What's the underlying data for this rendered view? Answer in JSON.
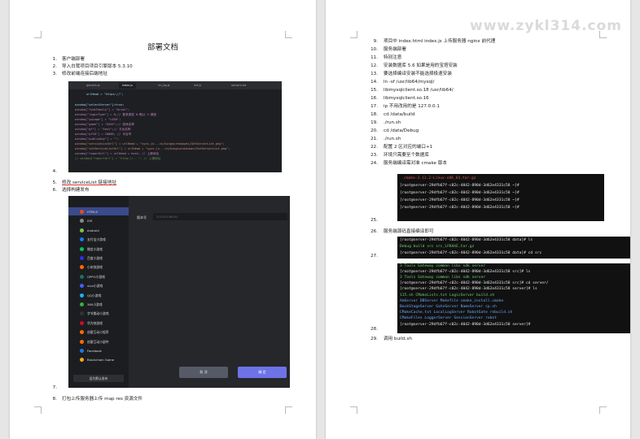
{
  "left": {
    "title": "部署文档",
    "items": [
      {
        "n": "1.",
        "text": "客户端部署"
      },
      {
        "n": "2.",
        "text": "导入白鹭项目项目引擎版本 5.3.10"
      },
      {
        "n": "3.",
        "text": "修改前端连接后端地址"
      },
      {
        "n": "4.",
        "text": ""
      },
      {
        "n": "5.",
        "text": "修改 serviceList 链接地址"
      },
      {
        "n": "6.",
        "text": "选择构建发布"
      },
      {
        "n": "7.",
        "text": ""
      },
      {
        "n": "8.",
        "text": "打包上传服务器上传 map res 资源文件"
      }
    ],
    "code_shot": {
      "tabs": [
        "gameIn.js",
        "index.js",
        "rm_bg.js",
        "init.js",
        "servers.txt"
      ],
      "lines": [
        "urlHead = \"https://\";",
        "",
        "window[\"selectServer\"]=true;",
        "window[\"fontFamily\"] = \"Arial\";",
        "window[\"loginType\"] = 0;// 登录类型 0:默认 1:微信",
        "window[\"ywLogo\"] = \"LOGO\";",
        "window[\"game\"] = \"XXXX\";// 游戏名称",
        "window[\"gf\"] = \"test\";// 平台名称",
        "window[\"pf10\"] = 10000; // 平台号",
        "window[\"publicKey\"] = \"\";",
        "window[\"serviceListUrl\"] = urlHead + \"sycs.js...cn/kingsurnhanwei/GetServerList.php\";",
        "window[\"setServiceListUrl\"] = urlHead + \"sycs.js...cn/kingsurnhanwei/SetServerList.php\";",
        "window[\"reportUrl\"] = urlHead + host; // 上报地址",
        "// window[\"reportUrl\"] = \"http://...\"; // 上报地址"
      ]
    },
    "build_shot": {
      "version_label": "版本号",
      "version_value": "20230706001",
      "platforms": [
        "HTML5",
        "iOS",
        "Android",
        "支付宝小游戏",
        "微信小游戏",
        "百度小游戏",
        "小米快游戏",
        "OPPO小游戏",
        "vivo小游戏",
        "QQ小游戏",
        "360小游戏",
        "字节跳动小游戏",
        "华为快游戏",
        "创意互动小程序",
        "创意互动小部件",
        "Facebook",
        "Blockchain Game"
      ],
      "platform_colors": [
        "#e34c26",
        "#888888",
        "#78c257",
        "#1677ff",
        "#07c160",
        "#2932e1",
        "#ff6900",
        "#1e6e5e",
        "#415fff",
        "#12b7f5",
        "#3dad3d",
        "#333333",
        "#cf0a2c",
        "#ff6a00",
        "#ff6a00",
        "#1877f2",
        "#f5a623"
      ],
      "set_default_button": "设为默认发布",
      "cancel_button": "取 消",
      "confirm_button": "确 定"
    }
  },
  "right": {
    "watermark": "www.zykl314.com",
    "items": [
      {
        "n": "9.",
        "text": "项目中 index.html index.js 上传服务器 nginx 前代理"
      },
      {
        "n": "10.",
        "text": "服务端部署"
      },
      {
        "n": "11.",
        "text": "特别注意"
      },
      {
        "n": "12.",
        "text": "安装数据库 5.6 如果是用的宝塔安装"
      },
      {
        "n": "13.",
        "text": "要选择编译安装不能选择极速安装"
      },
      {
        "n": "14.",
        "text": "ln -sf /usr/lib64/mysql/"
      },
      {
        "n": "15.",
        "text": "libmysqlclient.so.18 /usr/lib64/"
      },
      {
        "n": "16.",
        "text": "libmysqlclient.so.16"
      },
      {
        "n": "17.",
        "text": "ip 不用改用的是 127.0.0.1"
      },
      {
        "n": "18.",
        "text": "cd /data/build"
      },
      {
        "n": "19.",
        "text": "./run.sh"
      },
      {
        "n": "20.",
        "text": "cd /data/Debug"
      },
      {
        "n": "21.",
        "text": "./run.sh"
      },
      {
        "n": "22.",
        "text": "配置 2 区对应的端口+1"
      },
      {
        "n": "23.",
        "text": "环境只需要至个数据库"
      },
      {
        "n": "24.",
        "text": "服务端编译需对准 cmake 版本"
      },
      {
        "n": "25.",
        "text": ""
      },
      {
        "n": "26.",
        "text": "服务端源码直接编译即可"
      },
      {
        "n": "27.",
        "text": ""
      },
      {
        "n": "28.",
        "text": ""
      },
      {
        "n": "29.",
        "text": "调用 build.sh"
      }
    ],
    "term1": {
      "lines": [
        "cmake-3.12.2-Linux-x86_64.tar.gz",
        "[root@server-29dfb67f-c02c-4042-890d-3d62e4331c58 ~]#",
        "[root@server-29dfb67f-c02c-4042-890d-3d62e4331c58 ~]#",
        "[root@server-29dfb67f-c02c-4042-890d-3d62e4331c58 ~]#",
        "[root@server-29dfb67f-c02c-4042-890d-3d62e4331c58 ~]#"
      ]
    },
    "term2": {
      "lines": [
        "[root@server-29dfb67f-c02c-4042-890d-3d62e4331c58 data]# ls",
        "Debug  build  src  src_LFKAhE.tar.gz",
        "[root@server-29dfb67f-c02c-4042-890d-3d62e4331c58 data]# cd src"
      ]
    },
    "term3": {
      "lines": [
        "3  Tools  Gateway  common  libs  sdk  server",
        "[root@server-29dfb67f-c02c-4042-890d-3d62e4331c58 src]# ls",
        "3  Tools  Gateway  common  libs  sdk  server",
        "[root@server-29dfb67f-c02c-4042-890d-3d62e4331c58 src]# cd server/",
        "[root@server-29dfb67f-c02c-4042-890d-3d62e4331c58 server]# ls",
        "115.sh        CMakeLists.txt  LogicServer     build.sh",
        "AmServer      DBServer        Makefile        cmake_install.cmake",
        "BackStageServer GateServer    NameServer      cp.sh",
        "CMakeCache.txt  LocalLogServer RobotGate      rebuild.sh",
        "CMakeFiles    LoggerServer    SessionServer   robot",
        "[root@server-29dfb67f-c02c-4042-890d-3d62e4331c58 server]#"
      ]
    }
  }
}
